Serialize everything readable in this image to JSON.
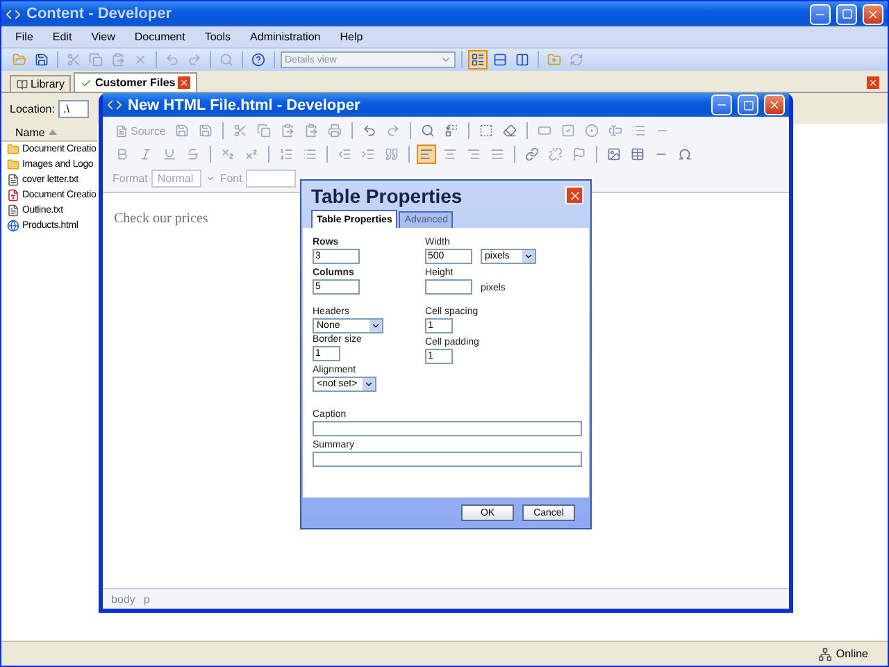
{
  "app_window": {
    "title": "Content - Developer"
  },
  "menu": [
    "File",
    "Edit",
    "View",
    "Document",
    "Tools",
    "Administration",
    "Help"
  ],
  "toolbar": {
    "view_select": "Details view"
  },
  "tabs": [
    {
      "label": "Library",
      "selected": false
    },
    {
      "label": "Customer Files",
      "selected": true
    }
  ],
  "location": {
    "label": "Location:",
    "value": ".\\"
  },
  "file_list": {
    "column": "Name",
    "items": [
      {
        "name": "Document Creatio",
        "kind": "folder"
      },
      {
        "name": "Images and Logo",
        "kind": "folder"
      },
      {
        "name": "cover letter.txt",
        "kind": "text"
      },
      {
        "name": "Document Creatio",
        "kind": "pdf"
      },
      {
        "name": "Outline.txt",
        "kind": "text"
      },
      {
        "name": "Products.html",
        "kind": "web"
      }
    ]
  },
  "editor": {
    "title": "New HTML File.html - Developer",
    "source_label": "Source",
    "format_label": "Format",
    "format_value": "Normal",
    "font_label": "Font",
    "content": "Check our prices",
    "path": [
      "body",
      "p"
    ]
  },
  "dialog": {
    "title": "Table Properties",
    "tabs": [
      {
        "label": "Table Properties",
        "selected": true
      },
      {
        "label": "Advanced",
        "selected": false
      }
    ],
    "rows": {
      "label": "Rows",
      "value": "3",
      "required": true
    },
    "columns": {
      "label": "Columns",
      "value": "5",
      "required": true
    },
    "width": {
      "label": "Width",
      "value": "500",
      "unit": "pixels"
    },
    "height": {
      "label": "Height",
      "unit": "pixels"
    },
    "headers": {
      "label": "Headers",
      "value": "None"
    },
    "border_size": {
      "label": "Border size",
      "value": "1"
    },
    "alignment": {
      "label": "Alignment",
      "value": "<not set>"
    },
    "cell_spacing": {
      "label": "Cell spacing",
      "value": "1"
    },
    "cell_padding": {
      "label": "Cell padding",
      "value": "1"
    },
    "caption": {
      "label": "Caption"
    },
    "summary": {
      "label": "Summary"
    },
    "buttons": [
      "OK",
      "Cancel"
    ]
  },
  "status_bar": {
    "status": "Online"
  }
}
